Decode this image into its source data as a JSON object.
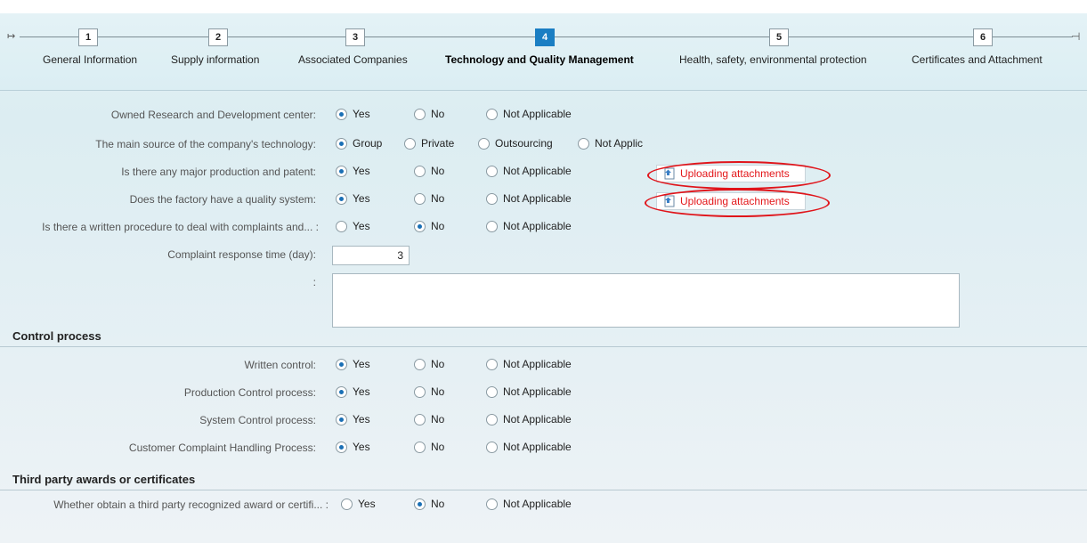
{
  "steps": [
    {
      "num": "1",
      "label": "General Information"
    },
    {
      "num": "2",
      "label": "Supply information"
    },
    {
      "num": "3",
      "label": "Associated Companies"
    },
    {
      "num": "4",
      "label": "Technology and Quality Management",
      "active": true
    },
    {
      "num": "5",
      "label": "Health, safety, environmental protection"
    },
    {
      "num": "6",
      "label": "Certificates and Attachment"
    }
  ],
  "nav_glyphs": {
    "start": "↦",
    "end": "→"
  },
  "rows": {
    "rd_center": {
      "label": "Owned Research and Development center:",
      "options": [
        "Yes",
        "No",
        "Not Applicable"
      ],
      "selected": "Yes"
    },
    "tech_source": {
      "label": "The main source of the company's technology:",
      "options": [
        "Group",
        "Private",
        "Outsourcing",
        "Not Applic"
      ],
      "selected": "Group"
    },
    "patent": {
      "label": "Is there any major production and patent:",
      "options": [
        "Yes",
        "No",
        "Not Applicable"
      ],
      "selected": "Yes"
    },
    "quality_system": {
      "label": "Does the factory have a quality system:",
      "options": [
        "Yes",
        "No",
        "Not Applicable"
      ],
      "selected": "Yes"
    },
    "complaint_procedure": {
      "label": "Is there a written procedure to deal with complaints and... :",
      "options": [
        "Yes",
        "No",
        "Not Applicable"
      ],
      "selected": "No"
    },
    "response_time": {
      "label": "Complaint response time (day):",
      "value": "3"
    },
    "notes": {
      "label": ":",
      "value": ""
    }
  },
  "upload": {
    "label": "Uploading attachments",
    "icon": "upload-document-icon"
  },
  "control_process": {
    "title": "Control process",
    "rows": [
      {
        "label": "Written control:",
        "options": [
          "Yes",
          "No",
          "Not Applicable"
        ],
        "selected": "Yes"
      },
      {
        "label": "Production Control process:",
        "options": [
          "Yes",
          "No",
          "Not Applicable"
        ],
        "selected": "Yes"
      },
      {
        "label": "System Control process:",
        "options": [
          "Yes",
          "No",
          "Not Applicable"
        ],
        "selected": "Yes"
      },
      {
        "label": "Customer Complaint Handling Process:",
        "options": [
          "Yes",
          "No",
          "Not Applicable"
        ],
        "selected": "Yes"
      }
    ]
  },
  "third_party": {
    "title": "Third party awards or certificates",
    "rows": [
      {
        "label": "Whether obtain a third party recognized award or certifi... :",
        "options": [
          "Yes",
          "No",
          "Not Applicable"
        ],
        "selected": "No"
      }
    ]
  },
  "colors": {
    "accent": "#1a7ec3",
    "highlight": "#e0141a",
    "upload_text": "#e3171a"
  }
}
